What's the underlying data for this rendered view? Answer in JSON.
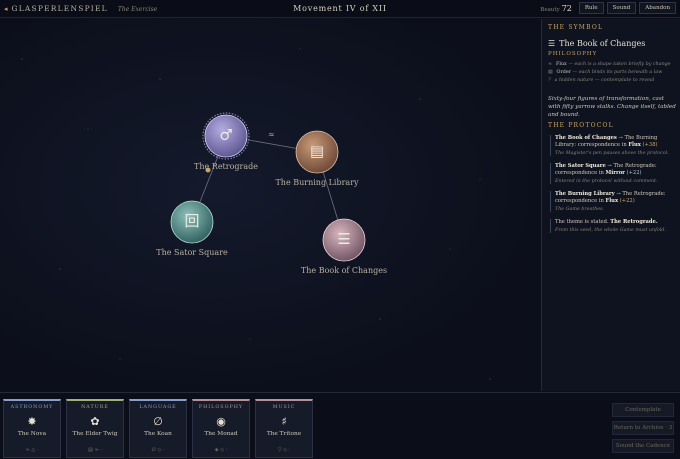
{
  "header": {
    "back_glyph": "◂",
    "title": "GLASPERLENSPIEL",
    "subtitle": "The Exercise",
    "movement": "Movement IV of XII",
    "beauty_label": "Beauty",
    "beauty_value": "72",
    "buttons": [
      "Rule",
      "Sound",
      "Abandon"
    ]
  },
  "canvas": {
    "edge_mark": "≈",
    "nodes": [
      {
        "label": "The Retrograde",
        "icon": "♂",
        "color": "#8f86c4"
      },
      {
        "label": "The Burning Library",
        "icon": "▤",
        "color": "#a8795a"
      },
      {
        "label": "The Sator Square",
        "icon": "回",
        "color": "#5f9a96"
      },
      {
        "label": "The Book of Changes",
        "icon": "☰",
        "color": "#b3909a"
      }
    ]
  },
  "panel": {
    "symbol_heading": "THE SYMBOL",
    "symbol": {
      "icon": "☰",
      "name": "The Book of Changes",
      "category": "PHILOSOPHY",
      "traits": [
        {
          "glyph": "≈",
          "name": "Flux",
          "text": "— each is a shape taken briefly by change"
        },
        {
          "glyph": "▤",
          "name": "Order",
          "text": "— each binds its parts beneath a law"
        },
        {
          "glyph": "?",
          "name": "",
          "text": "a hidden nature — contemplate to reveal"
        }
      ],
      "quote": "Sixty-four figures of transformation, cast with fifty yarrow stalks. Change itself, tabled and bound."
    },
    "protocol_heading": "THE PROTOCOL",
    "protocol": [
      {
        "a": "The Book of Changes",
        "b": "The Burning Library:",
        "mid": "correspondence in",
        "quality": "Flux",
        "delta": "(+38)",
        "delta_kind": "flux",
        "note": "The Magister's pen pauses above the protocol."
      },
      {
        "a": "The Sator Square",
        "b": "The Retrograde:",
        "mid": "correspondence in",
        "quality": "Mirror",
        "delta": "(+22)",
        "delta_kind": "mirror",
        "note": "Entered in the protocol without comment."
      },
      {
        "a": "The Burning Library",
        "b": "The Retrograde:",
        "mid": "correspondence in",
        "quality": "Flux",
        "delta": "(+22)",
        "delta_kind": "flux",
        "note": "The Game breathes."
      },
      {
        "a": "The theme is stated.",
        "b": "The Retrograde.",
        "mid": "",
        "quality": "",
        "delta": "",
        "delta_kind": "",
        "note": "From this seed, the whole Game must unfold."
      }
    ]
  },
  "hand": {
    "cards": [
      {
        "category": "ASTRONOMY",
        "icon": "✸",
        "name": "The Nova",
        "footer": "≈ △ ·",
        "color": "#8aa0c8"
      },
      {
        "category": "NATURE",
        "icon": "✿",
        "name": "The Elder Twig",
        "footer": "▤ ≈ ·",
        "color": "#9fb07a"
      },
      {
        "category": "LANGUAGE",
        "icon": "∅",
        "name": "The Koan",
        "footer": "∅ ◇ ·",
        "color": "#8aa0c8"
      },
      {
        "category": "PHILOSOPHY",
        "icon": "◉",
        "name": "The Monad",
        "footer": "◈ ◇ ·",
        "color": "#b3909a"
      },
      {
        "category": "MUSIC",
        "icon": "♯",
        "name": "The Tritone",
        "footer": "▽ ◇ ·",
        "color": "#b3909a"
      }
    ],
    "actions": [
      "Contemplate",
      "Return to Archive · 3",
      "Sound the Cadence"
    ]
  }
}
